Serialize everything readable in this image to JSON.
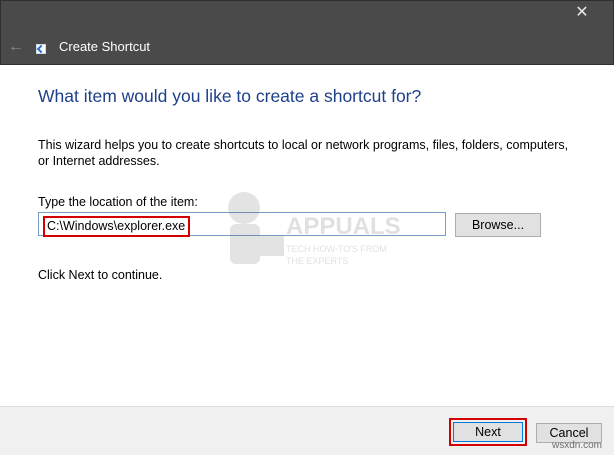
{
  "window": {
    "title": "Create Shortcut",
    "back_icon": "back-arrow-icon",
    "close_icon": "close-icon"
  },
  "content": {
    "heading": "What item would you like to create a shortcut for?",
    "description": "This wizard helps you to create shortcuts to local or network programs, files, folders, computers, or Internet addresses.",
    "location_label": "Type the location of the item:",
    "location_value": "C:\\Windows\\explorer.exe",
    "browse_label": "Browse...",
    "hint": "Click Next to continue."
  },
  "footer": {
    "next_label": "Next",
    "cancel_label": "Cancel"
  },
  "watermark": {
    "brand": "APPUALS",
    "tagline_1": "TECH HOW-TO'S FROM",
    "tagline_2": "THE EXPERTS",
    "site": "wsxdn.com"
  },
  "colors": {
    "title_bar": "#4a4a4a",
    "heading": "#1e3f8a",
    "highlight_red": "#d40000",
    "focus_blue": "#0078d7"
  }
}
